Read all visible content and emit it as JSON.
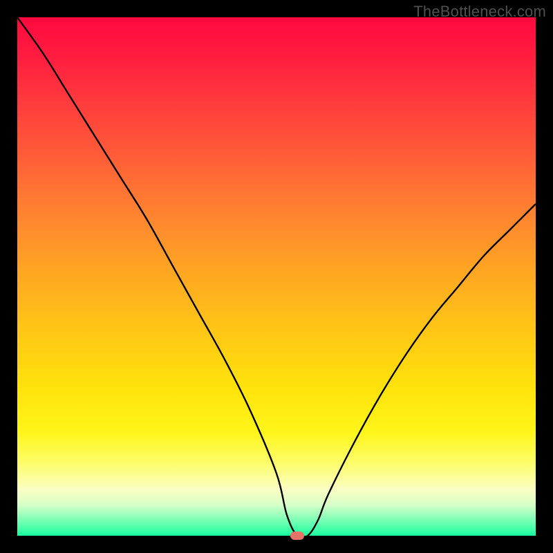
{
  "attribution": "TheBottleneck.com",
  "colors": {
    "frame": "#000000",
    "curve": "#000000",
    "marker": "#e57367",
    "gradient_top": "#ff093f",
    "gradient_bottom": "#18ff9e"
  },
  "chart_data": {
    "type": "line",
    "title": "",
    "xlabel": "",
    "ylabel": "",
    "xlim": [
      0,
      100
    ],
    "ylim": [
      0,
      100
    ],
    "grid": false,
    "legend": false,
    "minimum_marker": {
      "x": 54,
      "y": 0
    },
    "series": [
      {
        "name": "bottleneck-curve",
        "x": [
          0,
          5,
          10,
          15,
          20,
          25,
          30,
          35,
          40,
          45,
          50,
          52,
          54,
          56,
          58,
          60,
          65,
          70,
          75,
          80,
          85,
          90,
          95,
          100
        ],
        "values": [
          100,
          93,
          85,
          77,
          69,
          61,
          52,
          43,
          34,
          24,
          12,
          4,
          0,
          0,
          3,
          8,
          18,
          27,
          35,
          42,
          48,
          54,
          59,
          64
        ]
      }
    ]
  }
}
